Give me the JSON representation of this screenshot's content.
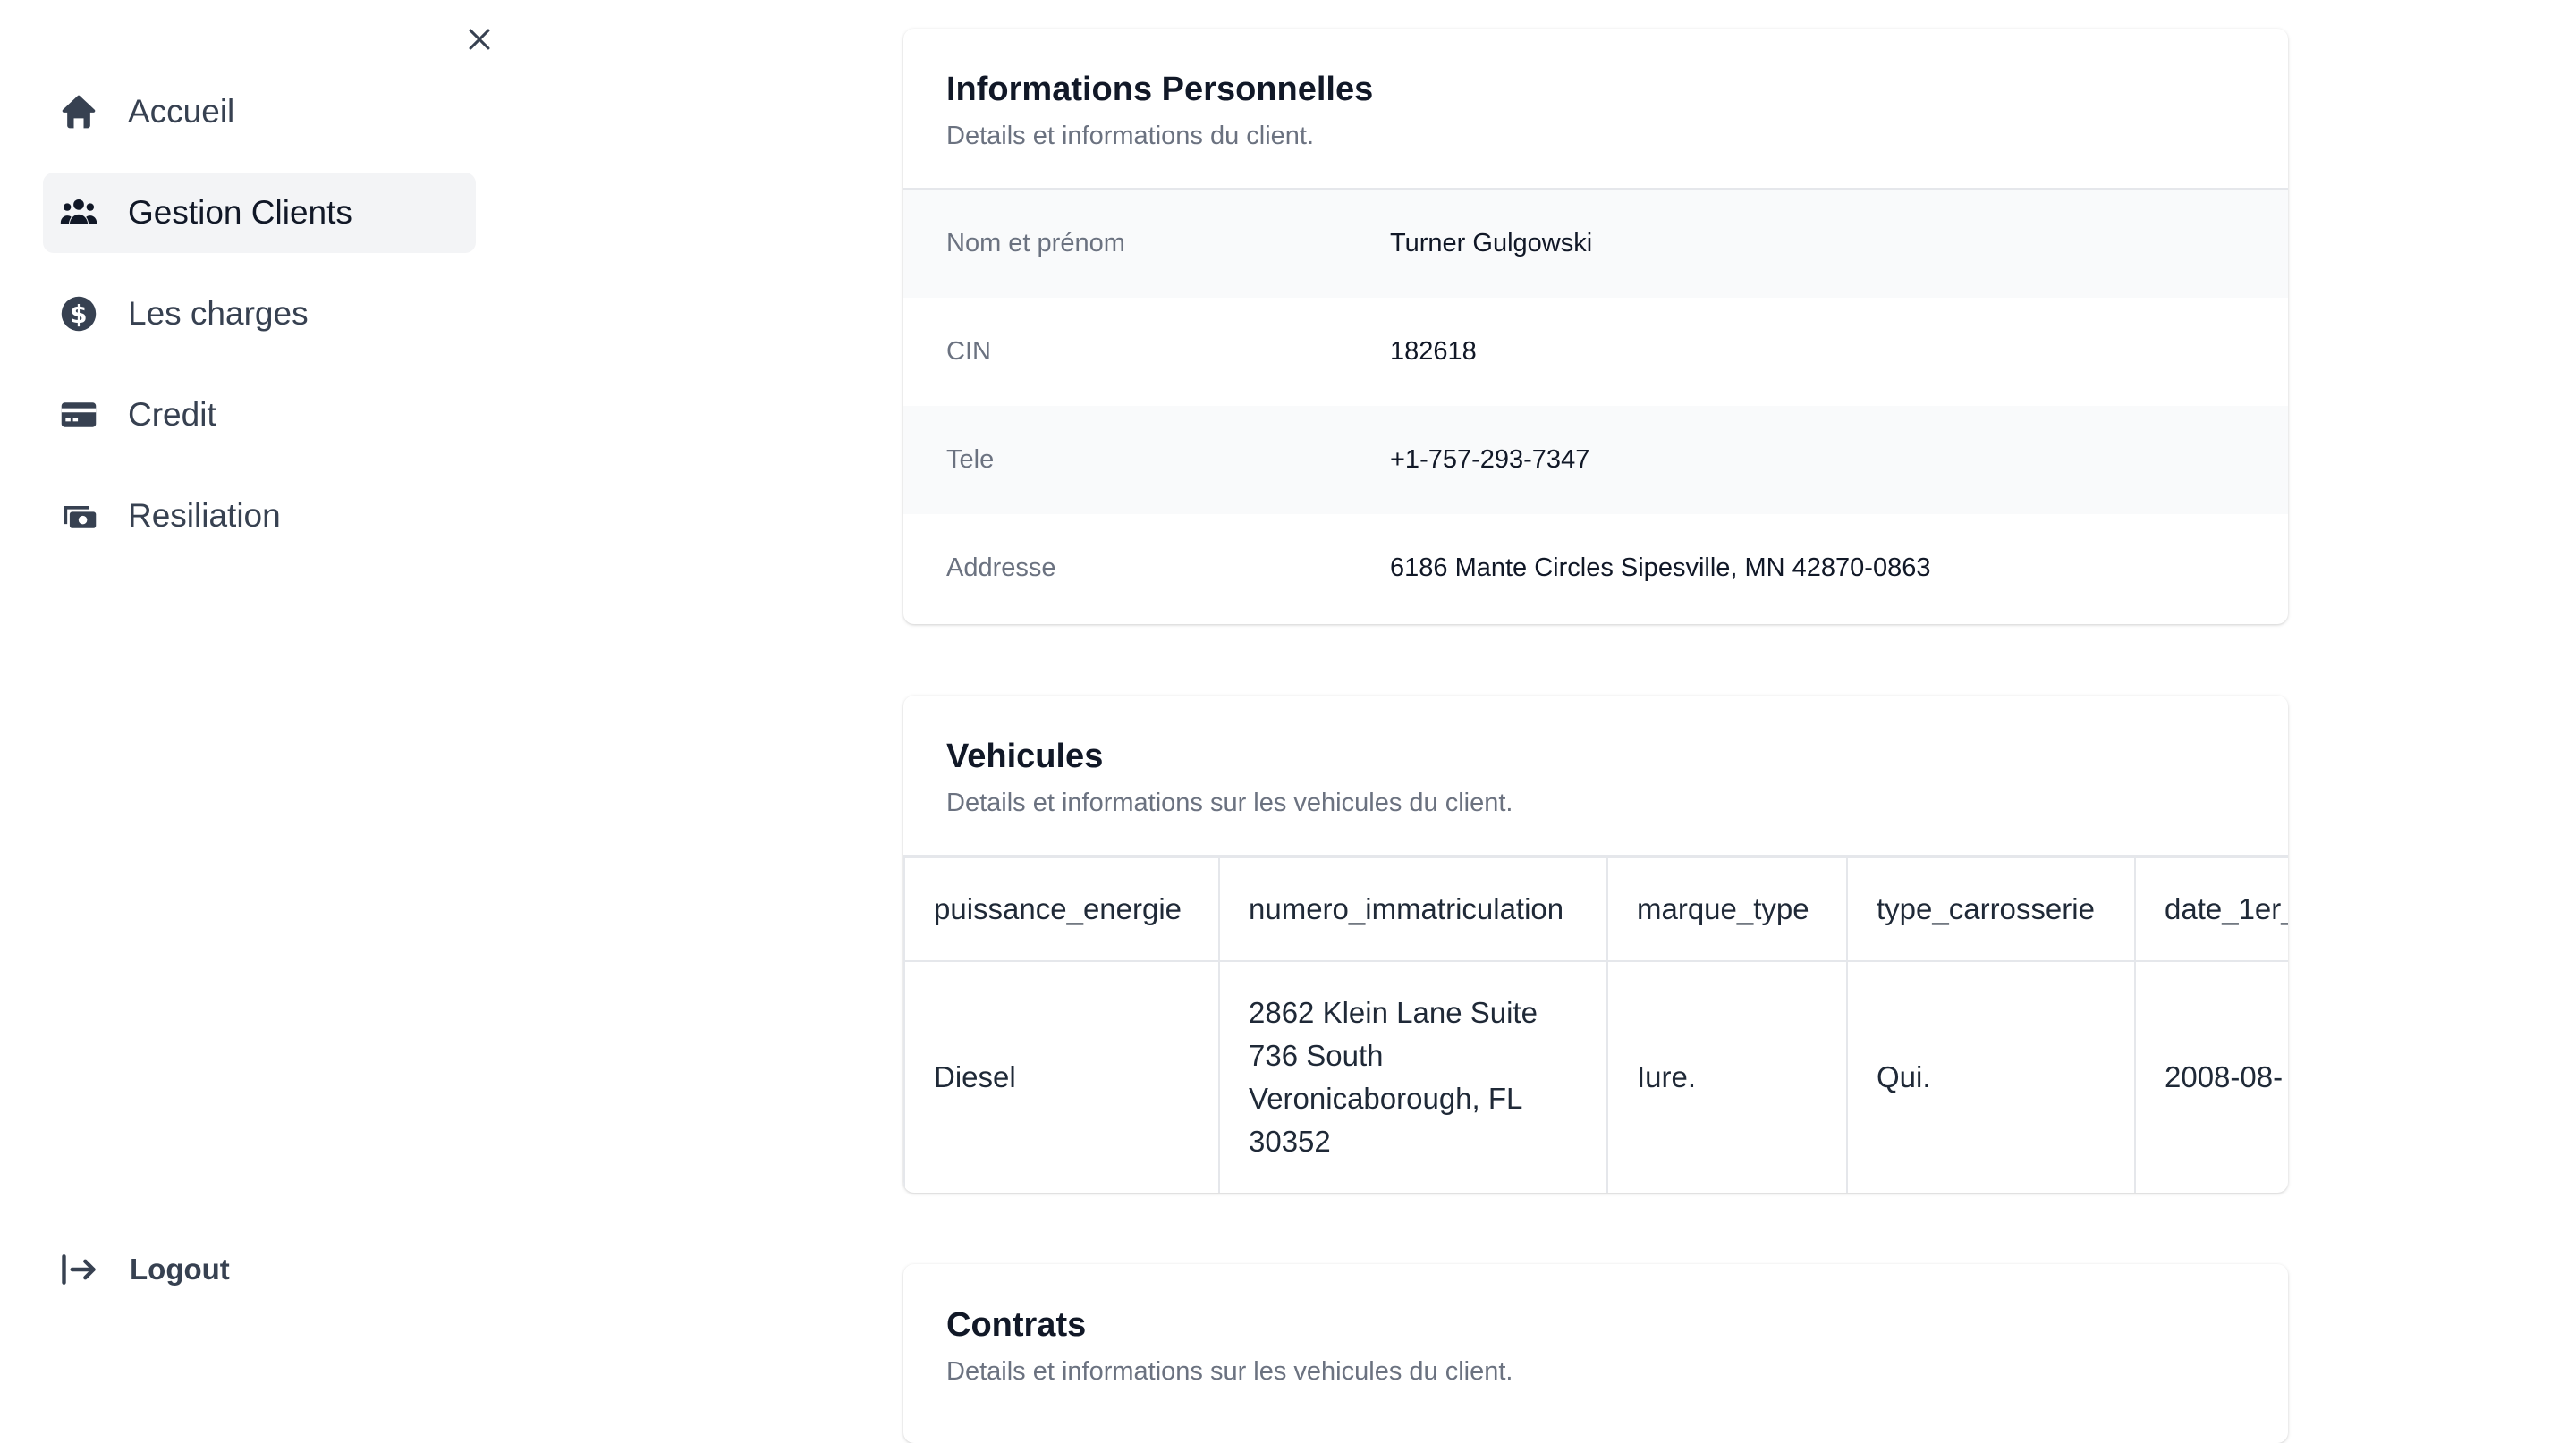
{
  "sidebar": {
    "items": [
      {
        "label": "Accueil",
        "icon": "home-icon"
      },
      {
        "label": "Gestion Clients",
        "icon": "users-icon"
      },
      {
        "label": "Les charges",
        "icon": "dollar-circle-icon"
      },
      {
        "label": "Credit",
        "icon": "credit-card-icon"
      },
      {
        "label": "Resiliation",
        "icon": "cash-stack-icon"
      }
    ],
    "active_index": 1,
    "logout_label": "Logout"
  },
  "personal": {
    "title": "Informations Personnelles",
    "subtitle": "Details et informations du client.",
    "rows": [
      {
        "label": "Nom et prénom",
        "value": "Turner Gulgowski"
      },
      {
        "label": "CIN",
        "value": "182618"
      },
      {
        "label": "Tele",
        "value": "+1-757-293-7347"
      },
      {
        "label": "Addresse",
        "value": "6186 Mante Circles Sipesville, MN 42870-0863"
      }
    ]
  },
  "vehicles": {
    "title": "Vehicules",
    "subtitle": "Details et informations sur les vehicules du client.",
    "columns": [
      "puissance_energie",
      "numero_immatriculation",
      "marque_type",
      "type_carrosserie",
      "date_1er_"
    ],
    "rows": [
      [
        "Diesel",
        "2862 Klein Lane Suite 736 South Veronicaborough, FL 30352",
        "Iure.",
        "Qui.",
        "2008-08-"
      ]
    ]
  },
  "contracts": {
    "title": "Contrats",
    "subtitle": "Details et informations sur les vehicules du client."
  },
  "colors": {
    "active_bg": "#f3f4f6",
    "shaded_row": "#f9fafb",
    "border": "#e5e7eb",
    "muted_text": "#6b7280"
  }
}
